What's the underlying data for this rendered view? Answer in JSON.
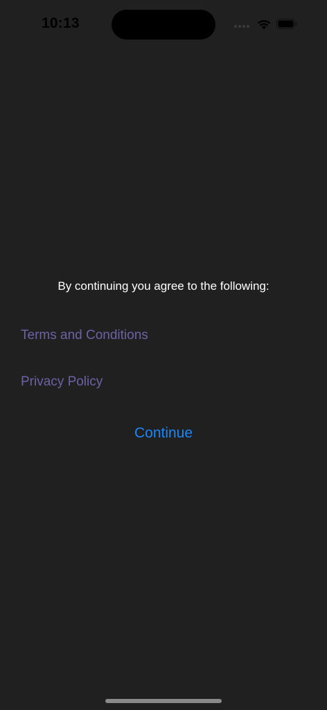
{
  "status_bar": {
    "time": "10:13",
    "icons": [
      "cellular-signal-icon",
      "wifi-icon",
      "battery-icon"
    ]
  },
  "consent": {
    "intro_text": "By continuing you agree to the following:",
    "terms_label": "Terms and Conditions",
    "privacy_label": "Privacy Policy",
    "continue_label": "Continue"
  },
  "colors": {
    "background": "#202020",
    "link": "#6e62a6",
    "accent": "#1e86f5",
    "text": "#ffffff"
  }
}
